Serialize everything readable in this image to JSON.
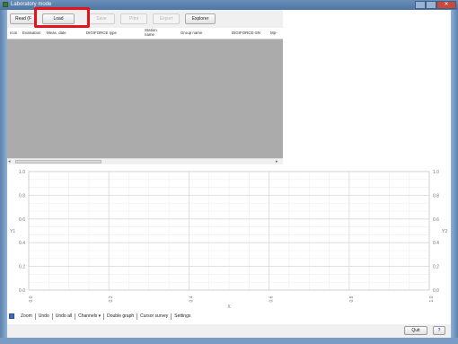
{
  "window": {
    "title": "Laboratory mode"
  },
  "toolbar": {
    "buttons": [
      {
        "label": "Read (F",
        "enabled": true
      },
      {
        "label": "Load",
        "enabled": true
      },
      {
        "label": "Save",
        "enabled": false
      },
      {
        "label": "Print",
        "enabled": false
      },
      {
        "label": "Export",
        "enabled": false
      },
      {
        "label": "Explorer",
        "enabled": true
      }
    ]
  },
  "table": {
    "columns": [
      "Icon",
      "Evaluation",
      "Meas. date",
      "DIGIFORCE type",
      "Station name",
      "Group name",
      "DIGIFORCE-SN",
      "Mp-"
    ]
  },
  "chart_data": {
    "type": "line",
    "title": "",
    "xlabel": "X",
    "ylabel": "Y1",
    "y2label": "Y2",
    "x_ticks": [
      "0.0",
      "0.2",
      "0.4",
      "0.6",
      "0.8",
      "1.0"
    ],
    "y_ticks": [
      "1.0",
      "0.8",
      "0.6",
      "0.4",
      "0.2",
      "0.0"
    ],
    "xlim": [
      0,
      1
    ],
    "ylim": [
      0,
      1
    ],
    "grid": true,
    "series": []
  },
  "bottom_toolbar": {
    "items": [
      "Zoom",
      "Undo",
      "Undo all",
      "Channels ▾",
      "Double graph",
      "Cursor survey",
      "Settings"
    ]
  },
  "status": {
    "quit_label": "Quit",
    "help_label": "?"
  }
}
